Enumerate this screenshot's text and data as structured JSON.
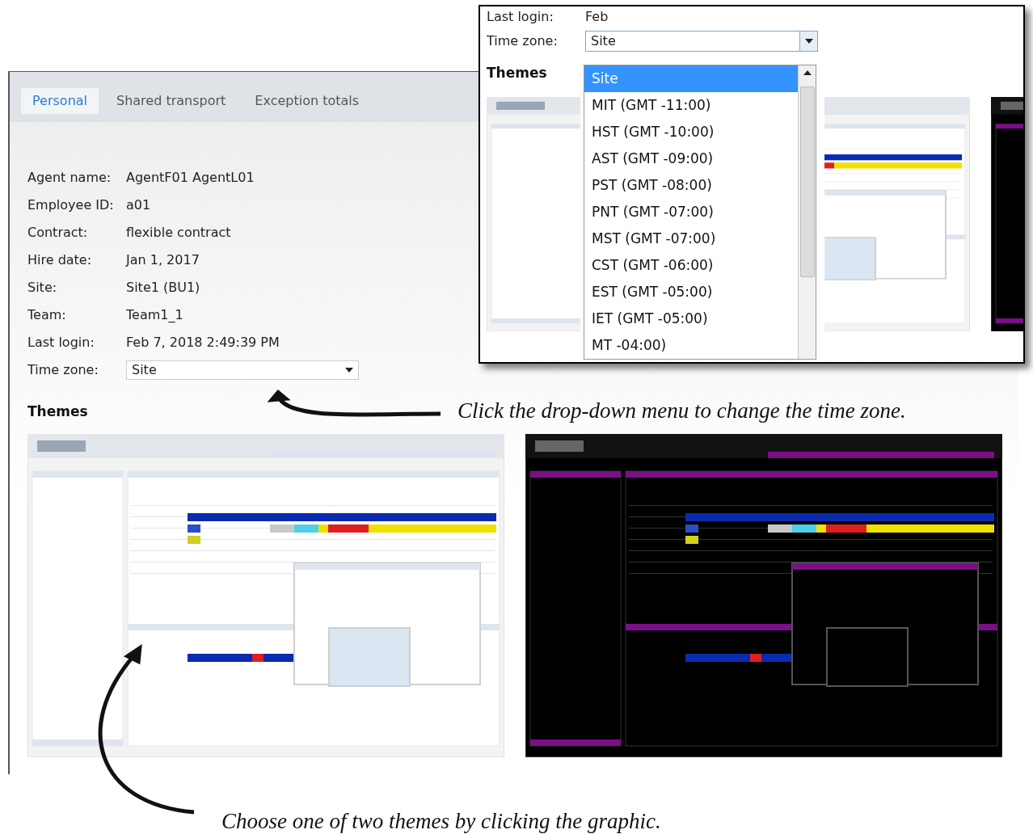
{
  "tabs": [
    {
      "label": "Personal",
      "selected": true
    },
    {
      "label": "Shared transport",
      "selected": false
    },
    {
      "label": "Exception totals",
      "selected": false
    }
  ],
  "fields": [
    {
      "label": "Agent name:",
      "value": "AgentF01 AgentL01"
    },
    {
      "label": "Employee ID:",
      "value": "a01"
    },
    {
      "label": "Contract:",
      "value": "flexible contract"
    },
    {
      "label": "Hire date:",
      "value": "Jan 1, 2017"
    },
    {
      "label": "Site:",
      "value": "Site1 (BU1)"
    },
    {
      "label": "Team:",
      "value": "Team1_1"
    },
    {
      "label": "Last login:",
      "value": "Feb 7, 2018 2:49:39 PM"
    }
  ],
  "time_zone": {
    "label": "Time zone:",
    "value": "Site"
  },
  "themes": {
    "title": "Themes",
    "options": [
      {
        "kind": "light"
      },
      {
        "kind": "dark"
      }
    ]
  },
  "callout": {
    "last_login_label": "Last login:",
    "last_login_value": "Feb",
    "time_zone_label": "Time zone:",
    "value": "Site",
    "themes_title": "Themes",
    "options": [
      {
        "label": "Site",
        "selected": true
      },
      {
        "label": "MIT (GMT -11:00)",
        "selected": false
      },
      {
        "label": "HST (GMT -10:00)",
        "selected": false
      },
      {
        "label": "AST (GMT -09:00)",
        "selected": false
      },
      {
        "label": "PST (GMT -08:00)",
        "selected": false
      },
      {
        "label": "PNT (GMT -07:00)",
        "selected": false
      },
      {
        "label": "MST (GMT -07:00)",
        "selected": false
      },
      {
        "label": "CST (GMT -06:00)",
        "selected": false
      },
      {
        "label": "EST (GMT -05:00)",
        "selected": false
      },
      {
        "label": "IET (GMT -05:00)",
        "selected": false
      },
      {
        "label": "MT -04:00)",
        "selected": false
      }
    ]
  },
  "annotations": [
    {
      "text": "Click the drop-down menu to change the time zone."
    },
    {
      "text": "Choose one of two themes by clicking the graphic."
    }
  ]
}
